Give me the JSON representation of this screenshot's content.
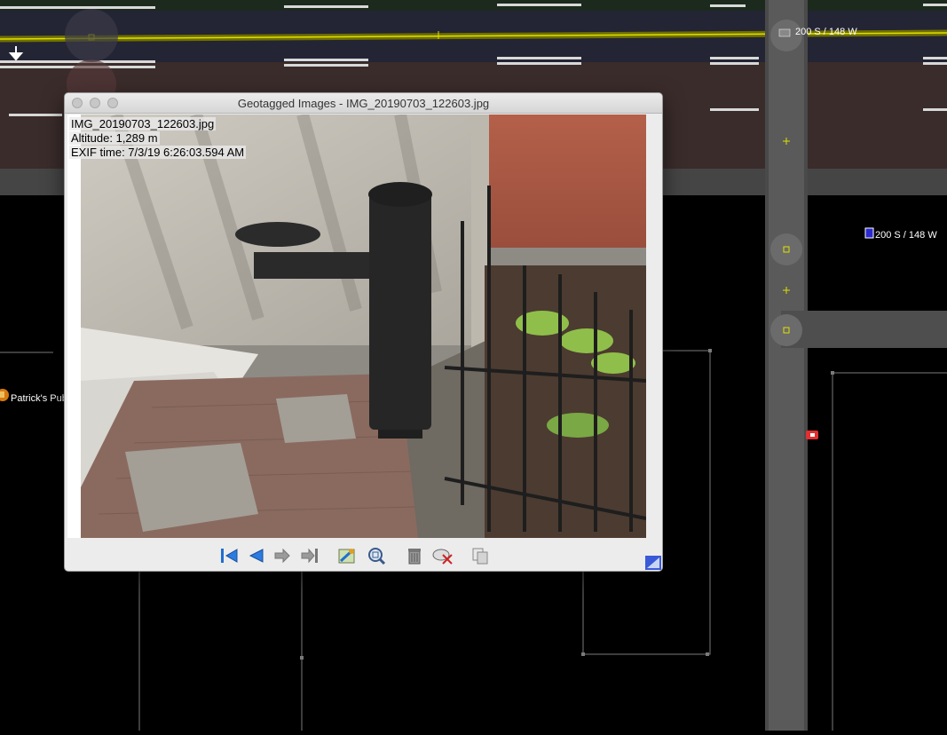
{
  "map": {
    "street_label_top": "200 S / 148 W",
    "street_label_right": "200 S / 148 W",
    "poi_label": "Patrick's Pub"
  },
  "dialog": {
    "title": "Geotagged Images - IMG_20190703_122603.jpg",
    "info": {
      "filename": "IMG_20190703_122603.jpg",
      "altitude": "Altitude: 1,289 m",
      "exif_time": "EXIF time: 7/3/19 6:26:03.594 AM"
    },
    "toolbar": {
      "icons": [
        "first-image-icon",
        "previous-image-icon",
        "next-image-icon",
        "last-image-icon",
        "center-view-icon",
        "zoom-best-fit-icon",
        "delete-icon",
        "remove-from-layer-icon",
        "copy-path-icon"
      ]
    }
  },
  "colors": {
    "road_yellow": "#d8d800",
    "map_background": "#000000",
    "accent_blue": "#1f6fd0"
  }
}
